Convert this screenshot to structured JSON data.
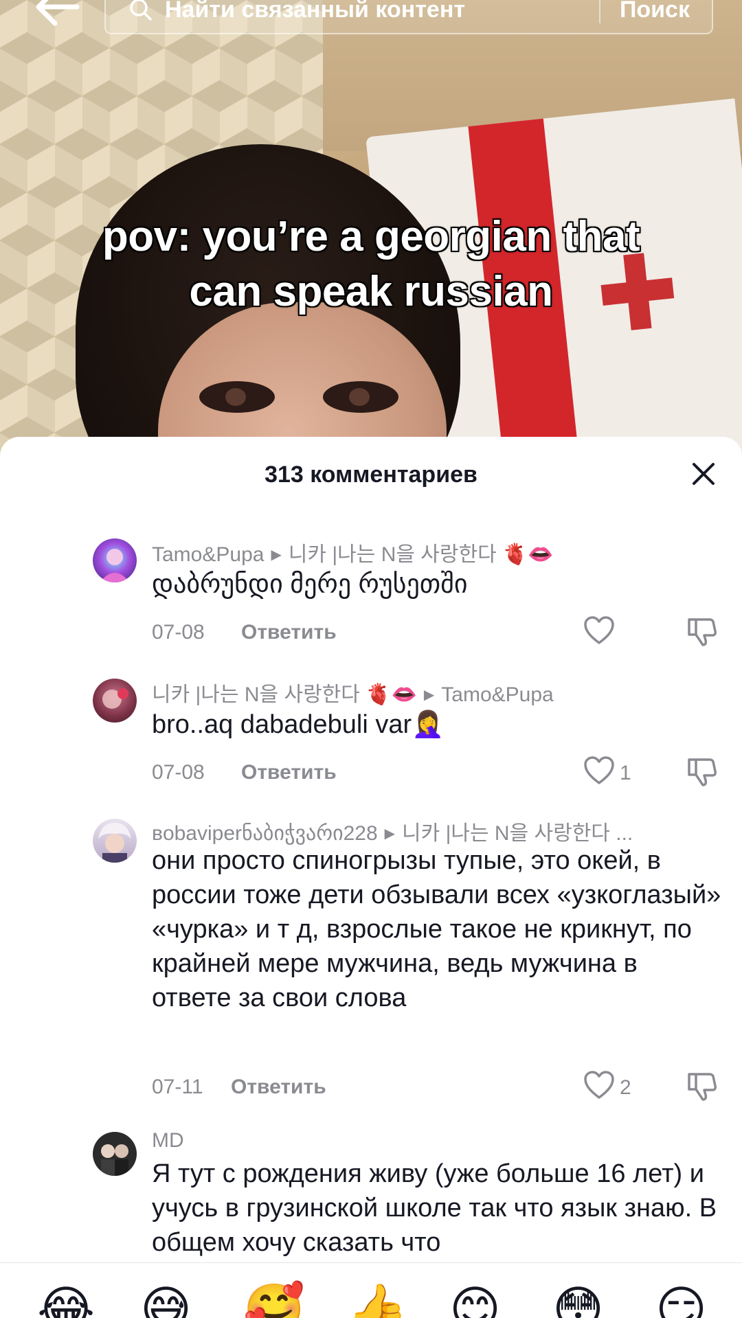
{
  "search": {
    "placeholder": "Найти связанный контент",
    "button_label": "Поиск"
  },
  "video": {
    "caption_line1": "pov: you’re a georgian that",
    "caption_line2": "can speak russian"
  },
  "comments_panel": {
    "title": "313 комментариев"
  },
  "comments": [
    {
      "author": "Tamo&Pupa",
      "reply_to": "니카 |나는 N을 사랑한다 🫀👄",
      "text": "დაბრუნდი მერე რუსეთში",
      "date": "07-08",
      "reply_label": "Ответить",
      "likes": ""
    },
    {
      "author": "니카 |나는 N을 사랑한다 🫀👄",
      "reply_to": "Tamo&Pupa",
      "text": "bro..aq dabadebuli var🤦‍♀️",
      "date": "07-08",
      "reply_label": "Ответить",
      "likes": "1"
    },
    {
      "author": "вobaviperნაბიჭვარი228",
      "reply_to": "니카 |나는 N을 사랑한다 ...",
      "text": "они просто спиногрызы тупые, это окей, в россии тоже дети обзывали всех «узкоглазый» «чурка» и т д, взрослые такое не крикнут, по крайней мере мужчина, ведь мужчина в ответе за свои слова",
      "date": "07-11",
      "reply_label": "Ответить",
      "likes": "2"
    },
    {
      "author": "MD",
      "text": "Я тут с рождения живу (уже больше 16 лет) и учусь в грузинской школе так что язык знаю. В общем хочу сказать что"
    }
  ],
  "emoji_bar": [
    "😂",
    "😅",
    "🥰",
    "👍",
    "😊",
    "😳",
    "😏"
  ],
  "colors": {
    "text_primary": "#161823",
    "text_secondary": "#8a8b91",
    "flag_red": "#d3262b"
  },
  "icons": [
    "back-arrow-icon",
    "search-icon",
    "close-icon",
    "heart-icon",
    "dislike-icon"
  ]
}
